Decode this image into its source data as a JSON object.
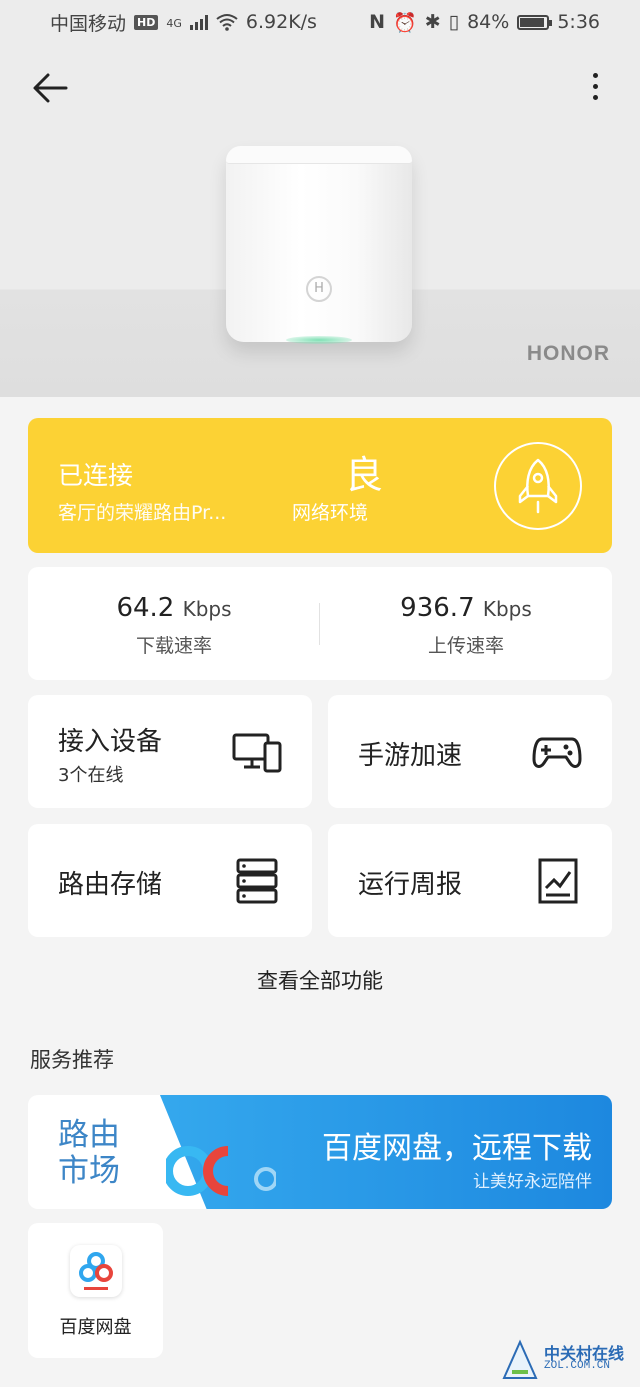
{
  "status_bar": {
    "carrier": "中国移动",
    "hd": "HD",
    "network": "4G",
    "speed": "6.92K/s",
    "battery": "84%",
    "time": "5:36"
  },
  "hero": {
    "brand": "HONOR"
  },
  "status_card": {
    "title": "已连接",
    "router_name": "客厅的荣耀路由Pr...",
    "quality": "良",
    "quality_label": "网络环境"
  },
  "speed": {
    "download_value": "64.2",
    "download_unit": "Kbps",
    "download_label": "下载速率",
    "upload_value": "936.7",
    "upload_unit": "Kbps",
    "upload_label": "上传速率"
  },
  "features": {
    "devices_label": "接入设备",
    "devices_sub": "3个在线",
    "game_label": "手游加速",
    "storage_label": "路由存储",
    "report_label": "运行周报"
  },
  "view_all": "查看全部功能",
  "services": {
    "section_title": "服务推荐",
    "banner_left": "路由市场",
    "banner_title": "百度网盘，远程下载",
    "banner_sub": "让美好永远陪伴",
    "app_label": "百度网盘"
  },
  "watermark": {
    "name": "中关村在线",
    "url": "ZOL.COM.CN"
  },
  "colors": {
    "accent_yellow": "#fcd234",
    "banner_blue": "#1d88df"
  }
}
